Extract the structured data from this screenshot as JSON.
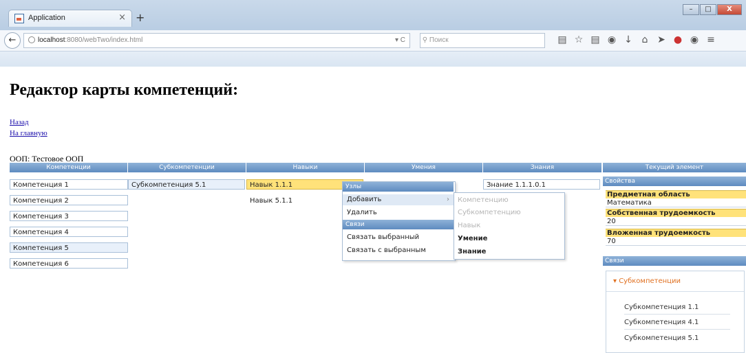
{
  "browser": {
    "tab_title": "Application",
    "tab_close": "×",
    "new_tab": "+",
    "url_host": "localhost",
    "url_rest": ":8080/webTwo/index.html",
    "search_placeholder": "Поиск",
    "win_min": "–",
    "win_max": "□",
    "win_close": "X"
  },
  "page": {
    "title": "Редактор карты компетенций:",
    "link_back": "Назад",
    "link_home": "На главную",
    "oop_label": "ООП: Тестовое ООП"
  },
  "columns": [
    "Компетенции",
    "Субкомпетенции",
    "Навыки",
    "Умения",
    "Знания",
    "Текущий элемент"
  ],
  "competencies": [
    "Компетенция 1",
    "Компетенция 2",
    "Компетенция 3",
    "Компетенция 4",
    "Компетенция 5",
    "Компетенция 6"
  ],
  "subcompetencies": [
    "Субкомпетенция 5.1"
  ],
  "skills": [
    "Навык 1.1.1",
    "Навык 5.1.1"
  ],
  "knowledge": [
    "Знание 1.1.1.0.1"
  ],
  "context_menu": {
    "header_nodes": "Узлы",
    "add": "Добавить",
    "delete": "Удалить",
    "header_links": "Связи",
    "link_selected": "Связать выбранный",
    "link_with_selected": "Связать с выбранным",
    "submenu": [
      {
        "label": "Компетенцию",
        "enabled": false
      },
      {
        "label": "Субкомпетенцию",
        "enabled": false
      },
      {
        "label": "Навык",
        "enabled": false
      },
      {
        "label": "Умение",
        "enabled": true
      },
      {
        "label": "Знание",
        "enabled": true
      }
    ]
  },
  "properties": {
    "header": "Свойства",
    "subject_area_label": "Предметная область",
    "subject_area_value": "Математика",
    "own_effort_label": "Собственная трудоемкость",
    "own_effort_value": "20",
    "nested_effort_label": "Вложенная трудоемкость",
    "nested_effort_value": "70",
    "links_header": "Связи",
    "accordion_title": "Субкомпетенции",
    "accordion_items": [
      "Субкомпетенция 1.1",
      "Субкомпетенция 4.1",
      "Субкомпетенция 5.1"
    ]
  },
  "colors": {
    "header_blue": "#5e8bc0",
    "selected_yellow": "#ffe27a",
    "accent_orange": "#e07020"
  }
}
